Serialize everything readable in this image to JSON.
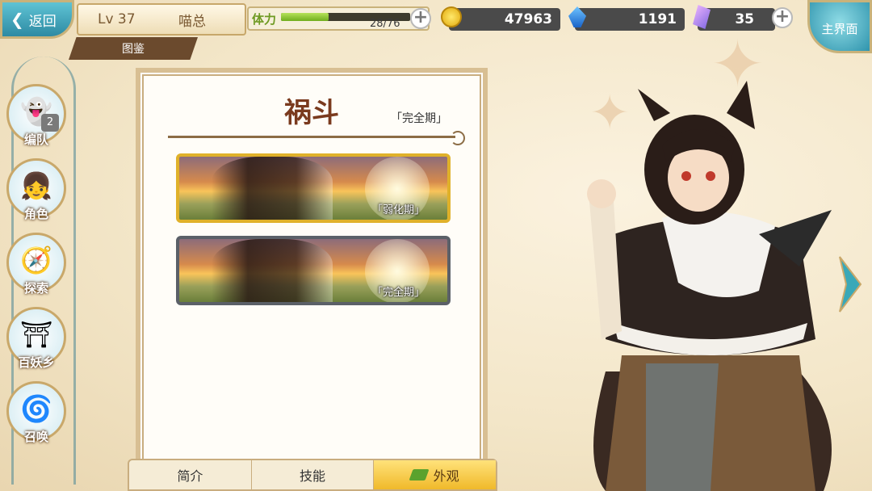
{
  "top_bar": {
    "back_label": "返回",
    "level": "Lv 37",
    "player_name": "喵总",
    "page_tab": "图鉴",
    "stamina_label": "体力",
    "stamina_text": "28/76",
    "stamina_fraction": 0.368,
    "gold": "47963",
    "soul": "1191",
    "crystal": "35",
    "home_label": "主界面"
  },
  "side_nav": {
    "items": [
      {
        "label": "编队",
        "badge": "2"
      },
      {
        "label": "角色"
      },
      {
        "label": "探索"
      },
      {
        "label": "百妖乡"
      },
      {
        "label": "召唤"
      }
    ]
  },
  "panel": {
    "title": "祸斗",
    "state": "「完全期」",
    "cards": [
      {
        "caption": "「弱化期」",
        "selected": true
      },
      {
        "caption": "「完全期」",
        "selected": false
      }
    ]
  },
  "tabs": [
    {
      "label": "简介"
    },
    {
      "label": "技能"
    },
    {
      "label": "外观",
      "active": true
    }
  ],
  "colors": {
    "accent_gold": "#f0b92a",
    "frame": "#d8bf93",
    "title_brown": "#7a3a1e",
    "stamina_green": "#6fae1e"
  }
}
